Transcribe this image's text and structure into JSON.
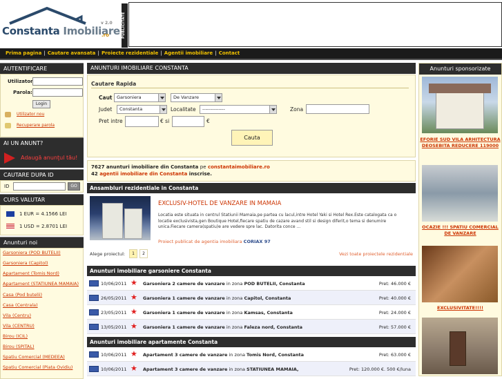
{
  "header": {
    "logo_main": "Constanta",
    "logo_second": "Imobiliare",
    "logo_ro": ".ro",
    "logo_version": "v 2.0",
    "publicitate": "PUBLICITATE"
  },
  "nav": {
    "items": [
      "Prima pagina",
      "Cautare avansata",
      "Proiecte rezidentiale",
      "Agentii imobiliare",
      "Contact"
    ]
  },
  "left": {
    "auth": {
      "title": "AUTENTIFICARE",
      "user_label": "Utilizator:",
      "pass_label": "Parola:",
      "login_button": "Login",
      "new_user": "Utilizator nou",
      "recover": "Recuperare parola"
    },
    "add": {
      "title": "AI UN ANUNT?",
      "button": "Adaugă anunţul tău!"
    },
    "search_id": {
      "title": "CAUTARE DUPA ID",
      "id_label": "ID",
      "go_button": "GO"
    },
    "valutar": {
      "title": "CURS VALUTAR",
      "eur": "1 EUR = 4.1566 LEI",
      "usd": "1 USD = 2.8701 LEI"
    },
    "news": {
      "title": "Anunturi noi",
      "items": [
        "Garsoniera (POD BUTELII)",
        "Garsoniera (Capitol)",
        "Apartament (Tomis Nord)",
        "Apartament (STATIUNEA MAMAIA)",
        "Casa (Pod butelii)",
        "Casa (Centrala)",
        "Vila (Centru)",
        "Vila (CENTRU)",
        "Birou (ICIL)",
        "Birou (SPITAL)",
        "Spatiu Comercial (MEDEEA)",
        "Spatiu Comercial (Piata Ovidiu)"
      ]
    }
  },
  "main": {
    "title": "ANUNTURI IMOBILIARE CONSTANTA",
    "search": {
      "title": "Cautare Rapida",
      "caut_label": "Caut",
      "type_value": "Garsoniera",
      "deal_value": "De Vanzare",
      "judet_label": "Judet",
      "judet_value": "Constanta",
      "localitate_label": "Localitate",
      "localitate_value": "--------------",
      "zona_label": "Zona",
      "pret_label": "Pret intre",
      "euro1": "€ si",
      "euro2": "€",
      "button": "Cauta"
    },
    "stats": {
      "count_text": "7627 anunturi imobiliare din Constanta",
      "pe": "pe",
      "site_link": "constantaimobiliare.ro",
      "agency_count": "42",
      "agency_link": "agentii imobiliare din Constanta",
      "inscrise": "inscrise."
    },
    "projects": {
      "heading": "Ansambluri rezidentiale in Constanta",
      "title": "EXCLUSIV-HOTEL DE VANZARE IN MAMAIA",
      "description": "Locatia este situata in centrul Statiunii Mamaia,pe partea cu lacul,intre Hotel Yaki si Hotel Rex.Este catalogata ca o locatie exclusivista,gen Boutique Hotel,fiecare spatiu de cazare avand stil si design diferit,o tema si denumire unica.Fiecare camera(spatiu)e are vedere spre lac. Datorita conce ...",
      "agency_prefix": "Proiect publicat de agentia imobiliara",
      "agency_name": "CORIAX 97",
      "pager_label": "Alege proiectul:",
      "pages": [
        "1",
        "2"
      ],
      "all_link": "Vezi toate proiectele rezidentiale"
    },
    "garsoniere": {
      "heading": "Anunturi imobiliare garsoniere Constanta",
      "rows": [
        {
          "date": "10/06/2011",
          "title": "Garsoniera 2 camere de vanzare",
          "in_zona": "in zona",
          "zone": "POD BUTELII, Constanta",
          "price": "Pret: 46.000 €"
        },
        {
          "date": "26/05/2011",
          "title": "Garsoniera 1 camere de vanzare",
          "in_zona": "in zona",
          "zone": "Capitol, Constanta",
          "price": "Pret: 40.000 €"
        },
        {
          "date": "23/05/2011",
          "title": "Garsoniera 1 camere de vanzare",
          "in_zona": "in zona",
          "zone": "Kamsas, Constanta",
          "price": "Pret: 24.000 €"
        },
        {
          "date": "13/05/2011",
          "title": "Garsoniera 1 camere de vanzare",
          "in_zona": "in zona",
          "zone": "Faleza nord, Constanta",
          "price": "Pret: 57.000 €"
        }
      ]
    },
    "apartamente": {
      "heading": "Anunturi imobiliare apartamente Constanta",
      "rows": [
        {
          "date": "10/06/2011",
          "title": "Apartament 3 camere de vanzare",
          "in_zona": "in zona",
          "zone": "Tomis Nord, Constanta",
          "price": "Pret: 63.000 €"
        },
        {
          "date": "10/06/2011",
          "title": "Apartament 3 camere de vanzare",
          "in_zona": "in zona",
          "zone": "STATIUNEA MAMAIA,",
          "price": "Pret: 120.000 €. 500 €/luna"
        }
      ]
    }
  },
  "right": {
    "title": "Anunturi sponsorizate",
    "ads": [
      {
        "caption": "EFORIE SUD VILA ARHITECTURA DEOSEBITA REDUCERE 119000"
      },
      {
        "caption": "OCAZIE !!! SPATIU COMERCIAL DE VANZARE"
      },
      {
        "caption": "EXCLUSIVITATE!!!!"
      },
      {
        "caption": ""
      }
    ]
  },
  "colors": {
    "dark_bar": "#2d2d2d",
    "nav_link": "#f2c200",
    "link": "#cc3300",
    "panel_bg": "#fffbe0"
  }
}
